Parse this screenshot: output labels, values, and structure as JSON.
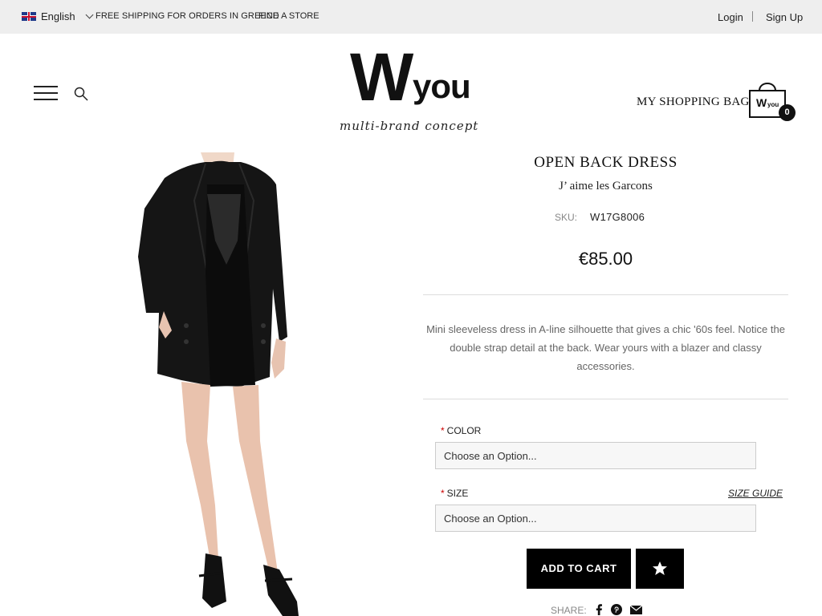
{
  "topbar": {
    "language": "English",
    "shipping_note": "FREE SHIPPING FOR ORDERS IN GREECE",
    "find_store": "FIND A STORE",
    "login": "Login",
    "signup": "Sign Up"
  },
  "header": {
    "logo_w": "W",
    "logo_you": "you",
    "logo_tagline": "multi-brand concept",
    "bag_label": "MY SHOPPING BAG",
    "bag_logo": "Wyou",
    "bag_count": "0"
  },
  "product": {
    "title": "OPEN BACK DRESS",
    "brand": "J’ aime les Garcons",
    "sku_label": "SKU:",
    "sku": "W17G8006",
    "price": "€85.00",
    "description": "Mini sleeveless dress in A-line silhouette that gives a chic '60s feel. Notice the double strap detail at the back. Wear yours with a blazer and classy accessories.",
    "color_label": "COLOR",
    "color_placeholder": "Choose an Option...",
    "size_label": "SIZE",
    "size_placeholder": "Choose an Option...",
    "size_guide": "SIZE GUIDE",
    "add_to_cart": "ADD TO CART",
    "share_label": "SHARE:"
  },
  "icons": [
    "uk-flag-icon",
    "chevron-down-icon",
    "menu-icon",
    "search-icon",
    "shopping-bag-icon",
    "star-icon",
    "facebook-icon",
    "pinterest-icon",
    "email-icon"
  ]
}
